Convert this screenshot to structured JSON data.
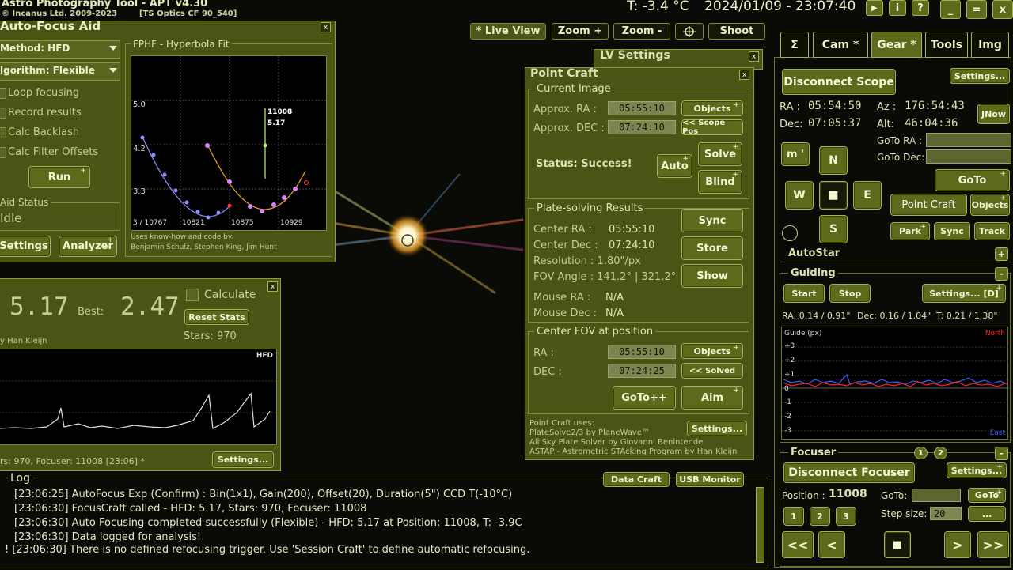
{
  "app": {
    "title": "Astro Photography Tool -  APT v4.30",
    "copyright": "© Incanus Ltd. 2009-2023",
    "profile": "[TS Optics CF 90_540]",
    "temperature": "T: -3.4 °C",
    "datetime": "2024/01/09 - 23:07:40",
    "win_play": "▶",
    "win_info": "i",
    "win_help": "?",
    "win_min": "_",
    "win_max": "=",
    "win_close": "x"
  },
  "toolbar": {
    "live_view": "* Live View",
    "zoom_in": "Zoom +",
    "zoom_out": "Zoom -",
    "shoot": "Shoot"
  },
  "autofocus": {
    "title": "Auto-Focus Aid",
    "close": "x",
    "method": "Method: HFD",
    "algorithm": "lgorithm: Flexible",
    "loop": "Loop focusing",
    "record": "Record results",
    "backlash": "Calc Backlash",
    "filter_offsets": "Calc Filter Offsets",
    "run": "Run",
    "aid_status_label": "Aid Status",
    "aid_status_value": "Idle",
    "settings": "Settings",
    "analyzer": "Analyzer"
  },
  "fphf": {
    "title": "FPHF - Hyperbola Fit",
    "y_top": "5.0",
    "y_mid": "4.2",
    "y_low": "3.3",
    "x_first": "3 / 10767",
    "x2": "10821",
    "x3": "10875",
    "x4": "10929",
    "marker_pos": "11008",
    "marker_val": "5.17",
    "credits_1": "Uses know-how and code by:",
    "credits_2": "Benjamin Schulz, Stephen King, Jim Hunt"
  },
  "focuscraft": {
    "close": "x",
    "hfd_value": "5.17",
    "best_label": "Best:",
    "best_value": "2.47",
    "calculate": "Calculate",
    "reset_stats": "Reset Stats",
    "stars": "Stars:  970",
    "author": "y Han Kleijn",
    "graph_label": "HFD",
    "status_line": "rs: 970, Focuser: 11008 [23:06] *",
    "settings": "Settings..."
  },
  "lv_settings": {
    "title": "LV Settings",
    "close": "x"
  },
  "pointcraft": {
    "title": "Point Craft",
    "close": "x",
    "current_image": "Current Image",
    "approx_ra_label": "Approx. RA :",
    "approx_ra": "05:55:10",
    "approx_dec_label": "Approx. DEC :",
    "approx_dec": "07:24:10",
    "objects": "Objects",
    "scope_pos": "<< Scope Pos",
    "status": "Status: Success!",
    "auto": "Auto",
    "solve": "Solve",
    "blind": "Blind",
    "results_title": "Plate-solving Results",
    "center_ra_label": "Center RA :",
    "center_ra": "05:55:10",
    "center_dec_label": "Center Dec :",
    "center_dec": "07:24:10",
    "resolution": "Resolution : 1.80\"/px",
    "fov_angle": "FOV Angle : 141.2° | 321.2°",
    "mouse_ra_label": "Mouse RA :",
    "mouse_ra": "N/A",
    "mouse_dec_label": "Mouse Dec :",
    "mouse_dec": "N/A",
    "sync": "Sync",
    "store": "Store",
    "show": "Show",
    "center_fov_title": "Center FOV at position",
    "ra_label": "RA :",
    "ra": "05:55:10",
    "dec_label": "DEC :",
    "dec": "07:24:25",
    "objects2": "Objects",
    "solved": "<< Solved",
    "goto": "GoTo++",
    "aim": "Aim",
    "uses_1": "Point Craft uses:",
    "uses_2": "PlateSolve2/3 by PlaneWave™",
    "uses_3": "All Sky Plate Solver by Giovanni Benintende",
    "uses_4": "ASTAP - Astrometric STAcking Program by Han Kleijn",
    "settings": "Settings..."
  },
  "log": {
    "title": "Log",
    "data_craft": "Data Craft",
    "usb_monitor": "USB Monitor",
    "lines": [
      "[23:06:25] AutoFocus Exp (Confirm) : Bin(1x1), Gain(200), Offset(20), Duration(5\") CCD T(-10°C)",
      "[23:06:30] FocusCraft called - HFD: 5.17, Stars: 970, Focuser: 11008",
      "[23:06:30] Auto Focusing completed successfully (Flexible) - HFD: 5.17 at Position: 11008, T: -3.9C",
      "[23:06:30] Data logged for analysis!",
      "! [23:06:30] There is no defined refocusing trigger. Use 'Session Craft' to define automatic refocusing."
    ]
  },
  "tabs": {
    "sigma": "Σ",
    "cam": "Cam *",
    "gear": "Gear *",
    "tools": "Tools",
    "img": "Img"
  },
  "gear": {
    "disconnect_scope": "Disconnect Scope",
    "settings": "Settings...",
    "ra_label": "RA :",
    "ra": "05:54:50",
    "dec_label": "Dec:",
    "dec": "07:05:37",
    "az_label": "Az :",
    "az": "176:54:43",
    "alt_label": "Alt:",
    "alt": "46:04:36",
    "jnow": "JNow",
    "goto_ra": "GoTo RA :",
    "goto_dec": "GoTo Dec:",
    "m_btn": "m '",
    "n": "N",
    "w": "W",
    "stop": "■",
    "e": "E",
    "s": "S",
    "goto": "GoTo",
    "point_craft": "Point Craft",
    "objects": "Objects",
    "park": "Park",
    "sync": "Sync",
    "track": "Track"
  },
  "autostar": {
    "title": "AutoStar",
    "btn": "+"
  },
  "guiding": {
    "title": "Guiding",
    "btn": "-",
    "start": "Start",
    "stop": "Stop",
    "settings": "Settings... [D]",
    "stats_ra": "RA: 0.14 / 0.91\"",
    "stats_dec": "Dec: 0.16 / 1.04\"",
    "stats_t": "T: 0.21 / 1.38\"",
    "graph_label": "Guide (px)",
    "north": "North",
    "east": "East",
    "y_ticks": [
      "+3",
      "+2",
      "+1",
      "0",
      "-1",
      "-2",
      "-3"
    ],
    "ra_color": "#3b5cff",
    "dec_color": "#ff2020"
  },
  "focuser": {
    "title": "Focuser",
    "one": "1",
    "two": "2",
    "btn": "-",
    "disconnect": "Disconnect Focuser",
    "settings": "Settings...",
    "position_label": "Position :",
    "position": "11008",
    "goto_label": "GoTo:",
    "goto_btn": "GoTo",
    "step_size_label": "Step size:",
    "step_size": "20",
    "p1": "1",
    "p2": "2",
    "p3": "3",
    "dots": "...",
    "ll": "<<",
    "l": "<",
    "stop": "■",
    "r": ">",
    "rr": ">>"
  }
}
